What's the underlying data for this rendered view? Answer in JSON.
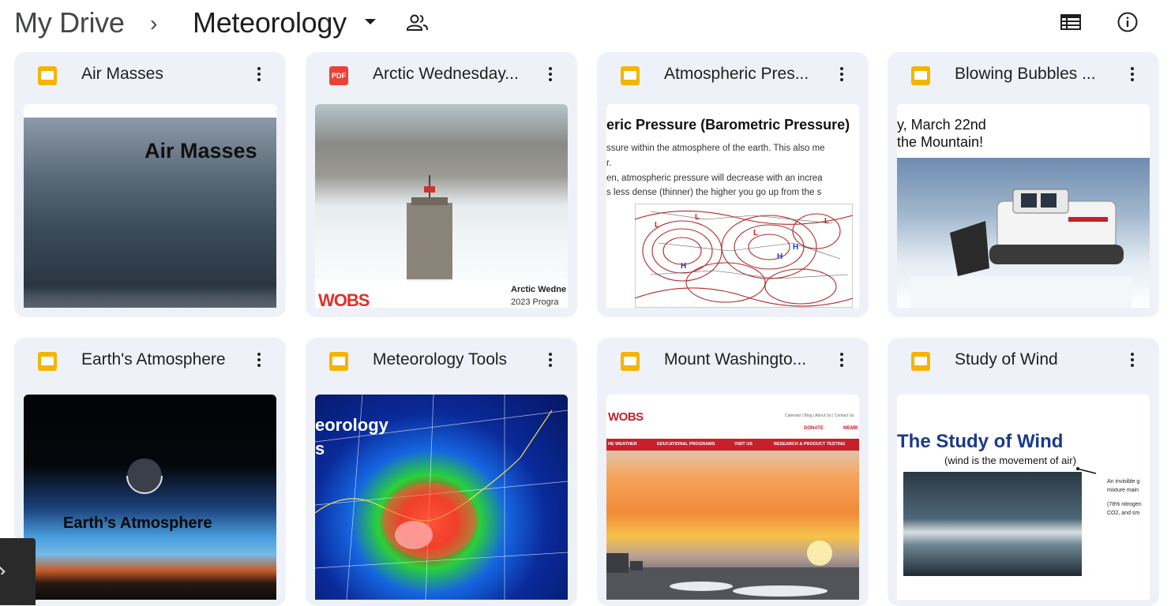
{
  "breadcrumb": {
    "root": "My Drive",
    "separator": "›",
    "current": "Meteorology"
  },
  "icons": {
    "shared": "people-icon",
    "view_toggle": "list-view-icon",
    "info": "info-icon",
    "slides": "slides-file-icon",
    "pdf": "pdf-file-icon",
    "more": "more-vert-icon"
  },
  "colors": {
    "card_bg": "#eef2f8",
    "slides": "#f5b400",
    "pdf": "#ea4335"
  },
  "files": [
    {
      "name": "Air Masses",
      "type": "slides",
      "thumb_title": "Air Masses"
    },
    {
      "name": "Arctic Wednesday...",
      "type": "pdf",
      "pdf_label": "PDF",
      "thumb_logo": "WOBS",
      "thumb_caption1": "Arctic Wedne",
      "thumb_caption2": "2023 Progra"
    },
    {
      "name": "Atmospheric Pres...",
      "type": "slides",
      "thumb_title": "eric Pressure (Barometric Pressure)",
      "thumb_line1": "ssure within the atmosphere of the earth. This also me",
      "thumb_line2": "r.",
      "thumb_line3": "en, atmospheric pressure will decrease with an increa",
      "thumb_line4": "s less dense (thinner) the higher you go up from the s"
    },
    {
      "name": "Blowing Bubbles ...",
      "type": "slides",
      "thumb_line1": "y, March 22nd",
      "thumb_line2": "the Mountain!"
    },
    {
      "name": "Earth's Atmosphere",
      "type": "slides",
      "thumb_title": "Earth’s Atmosphere"
    },
    {
      "name": "Meteorology Tools",
      "type": "slides",
      "thumb_title1": "eorology",
      "thumb_title2": "s"
    },
    {
      "name": "Mount Washingto...",
      "type": "slides",
      "thumb_logo": "WOBS",
      "thumb_nav": [
        "HE WEATHER",
        "EDUCATIONAL PROGRAMS",
        "VISIT US",
        "RESEARCH & PRODUCT TESTING"
      ],
      "thumb_donate": "DONATE",
      "thumb_member": "MEMB",
      "thumb_toplinks": "Calendar | Blog | About Us | Contact Us"
    },
    {
      "name": "Study of Wind",
      "type": "slides",
      "thumb_title": "The Study of Wind",
      "thumb_subtitle": "(wind is the movement of air)",
      "thumb_side1": "An invisible g",
      "thumb_side2": "mixture main",
      "thumb_side3": "(78% nitrogen",
      "thumb_side4": "CO2, and sm"
    }
  ]
}
